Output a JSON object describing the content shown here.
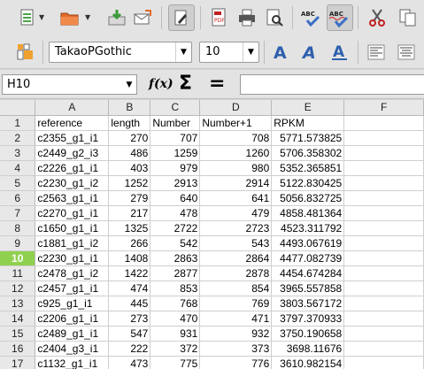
{
  "toolbar": {
    "icons": [
      "new-document-icon",
      "open-folder-icon",
      "save-icon",
      "email-icon",
      "edit-mode-icon",
      "export-pdf-icon",
      "print-icon",
      "print-preview-icon",
      "spellcheck-icon",
      "autospellcheck-icon",
      "cut-icon",
      "copy-icon"
    ],
    "pdf_label": "PDF",
    "abc_label": "ABC"
  },
  "format": {
    "font_name": "TakaoPGothic",
    "font_size": "10",
    "bold_glyph": "A",
    "italic_glyph": "A",
    "underline_glyph": "A"
  },
  "formula_bar": {
    "cell_ref": "H10",
    "fx_label": "f(x)",
    "sum_label": "Σ",
    "equals_label": "=",
    "content": ""
  },
  "sheet": {
    "columns": [
      "A",
      "B",
      "C",
      "D",
      "E",
      "F"
    ],
    "active_row": 10,
    "rows": [
      {
        "n": "1",
        "cells": [
          "reference",
          "length",
          "Number",
          "Number+1",
          "RPKM",
          ""
        ]
      },
      {
        "n": "2",
        "cells": [
          "c2355_g1_i1",
          "270",
          "707",
          "708",
          "5771.573825",
          ""
        ]
      },
      {
        "n": "3",
        "cells": [
          "c2449_g2_i3",
          "486",
          "1259",
          "1260",
          "5706.358302",
          ""
        ]
      },
      {
        "n": "4",
        "cells": [
          "c2226_g1_i1",
          "403",
          "979",
          "980",
          "5352.365851",
          ""
        ]
      },
      {
        "n": "5",
        "cells": [
          "c2230_g1_i2",
          "1252",
          "2913",
          "2914",
          "5122.830425",
          ""
        ]
      },
      {
        "n": "6",
        "cells": [
          "c2563_g1_i1",
          "279",
          "640",
          "641",
          "5056.832725",
          ""
        ]
      },
      {
        "n": "7",
        "cells": [
          "c2270_g1_i1",
          "217",
          "478",
          "479",
          "4858.481364",
          ""
        ]
      },
      {
        "n": "8",
        "cells": [
          "c1650_g1_i1",
          "1325",
          "2722",
          "2723",
          "4523.311792",
          ""
        ]
      },
      {
        "n": "9",
        "cells": [
          "c1881_g1_i2",
          "266",
          "542",
          "543",
          "4493.067619",
          ""
        ]
      },
      {
        "n": "10",
        "cells": [
          "c2230_g1_i1",
          "1408",
          "2863",
          "2864",
          "4477.082739",
          ""
        ]
      },
      {
        "n": "11",
        "cells": [
          "c2478_g1_i2",
          "1422",
          "2877",
          "2878",
          "4454.674284",
          ""
        ]
      },
      {
        "n": "12",
        "cells": [
          "c2457_g1_i1",
          "474",
          "853",
          "854",
          "3965.557858",
          ""
        ]
      },
      {
        "n": "13",
        "cells": [
          "c925_g1_i1",
          "445",
          "768",
          "769",
          "3803.567172",
          ""
        ]
      },
      {
        "n": "14",
        "cells": [
          "c2206_g1_i1",
          "273",
          "470",
          "471",
          "3797.370933",
          ""
        ]
      },
      {
        "n": "15",
        "cells": [
          "c2489_g1_i1",
          "547",
          "931",
          "932",
          "3750.190658",
          ""
        ]
      },
      {
        "n": "16",
        "cells": [
          "c2404_g3_i1",
          "222",
          "372",
          "373",
          "3698.11676",
          ""
        ]
      },
      {
        "n": "17",
        "cells": [
          "c1132_g1_i1",
          "473",
          "775",
          "776",
          "3610.982154",
          ""
        ]
      }
    ]
  },
  "colors": {
    "active_row_header": "#8fd14f",
    "toolbar_bg": "#e3e3e3",
    "grid_line": "#cfcfcf"
  }
}
